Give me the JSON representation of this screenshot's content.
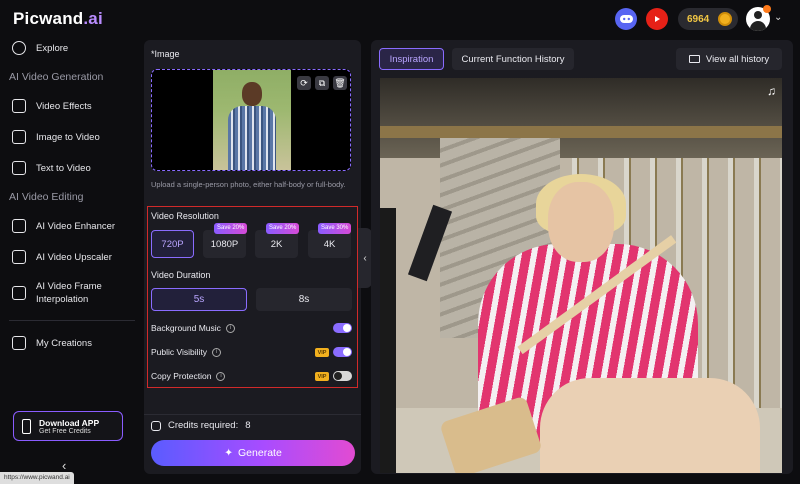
{
  "brand": {
    "name": "Picwand",
    "suffix": ".ai"
  },
  "header": {
    "credits": "6964"
  },
  "sidebar": {
    "explore": "Explore",
    "sections": [
      "AI Video Generation",
      "AI Video Editing"
    ],
    "items": [
      {
        "label": "Video Effects",
        "icon": "sparkle-icon"
      },
      {
        "label": "Image to Video",
        "icon": "image-icon"
      },
      {
        "label": "Text to Video",
        "icon": "text-icon"
      },
      {
        "label": "AI Video Enhancer",
        "icon": "enhance-icon"
      },
      {
        "label": "AI Video Upscaler",
        "icon": "upscale-icon"
      },
      {
        "label": "AI Video Frame",
        "label2": "Interpolation",
        "icon": "frame-icon"
      },
      {
        "label": "My Creations",
        "icon": "folder-icon"
      }
    ],
    "download": {
      "title": "Download APP",
      "subtitle": "Get Free Credits"
    }
  },
  "status_url": "https://www.picwand.ai",
  "form": {
    "image_label": "*Image",
    "upload_hint": "Upload a single-person photo, either half-body or full-body.",
    "resolution_label": "Video Resolution",
    "resolutions": [
      {
        "label": "720P",
        "badge": "",
        "active": true
      },
      {
        "label": "1080P",
        "badge": "Save 20%",
        "active": false
      },
      {
        "label": "2K",
        "badge": "Save 20%",
        "active": false
      },
      {
        "label": "4K",
        "badge": "Save 30%",
        "active": false
      }
    ],
    "duration_label": "Video Duration",
    "durations": [
      {
        "label": "5s",
        "active": true
      },
      {
        "label": "8s",
        "active": false
      }
    ],
    "options": [
      {
        "label": "Background Music",
        "vip": "",
        "on": true
      },
      {
        "label": "Public Visibility",
        "vip": "VIP",
        "on": true
      },
      {
        "label": "Copy Protection",
        "vip": "VIP",
        "on": false
      }
    ],
    "credits_required_label": "Credits required:",
    "credits_required_value": "8",
    "generate_label": "Generate"
  },
  "right": {
    "tabs": [
      "Inspiration",
      "Current Function History"
    ],
    "view_all": "View all history"
  },
  "colors": {
    "accent": "#8a6cff",
    "highlight": "#d12a2a",
    "gold": "#f2c744"
  }
}
